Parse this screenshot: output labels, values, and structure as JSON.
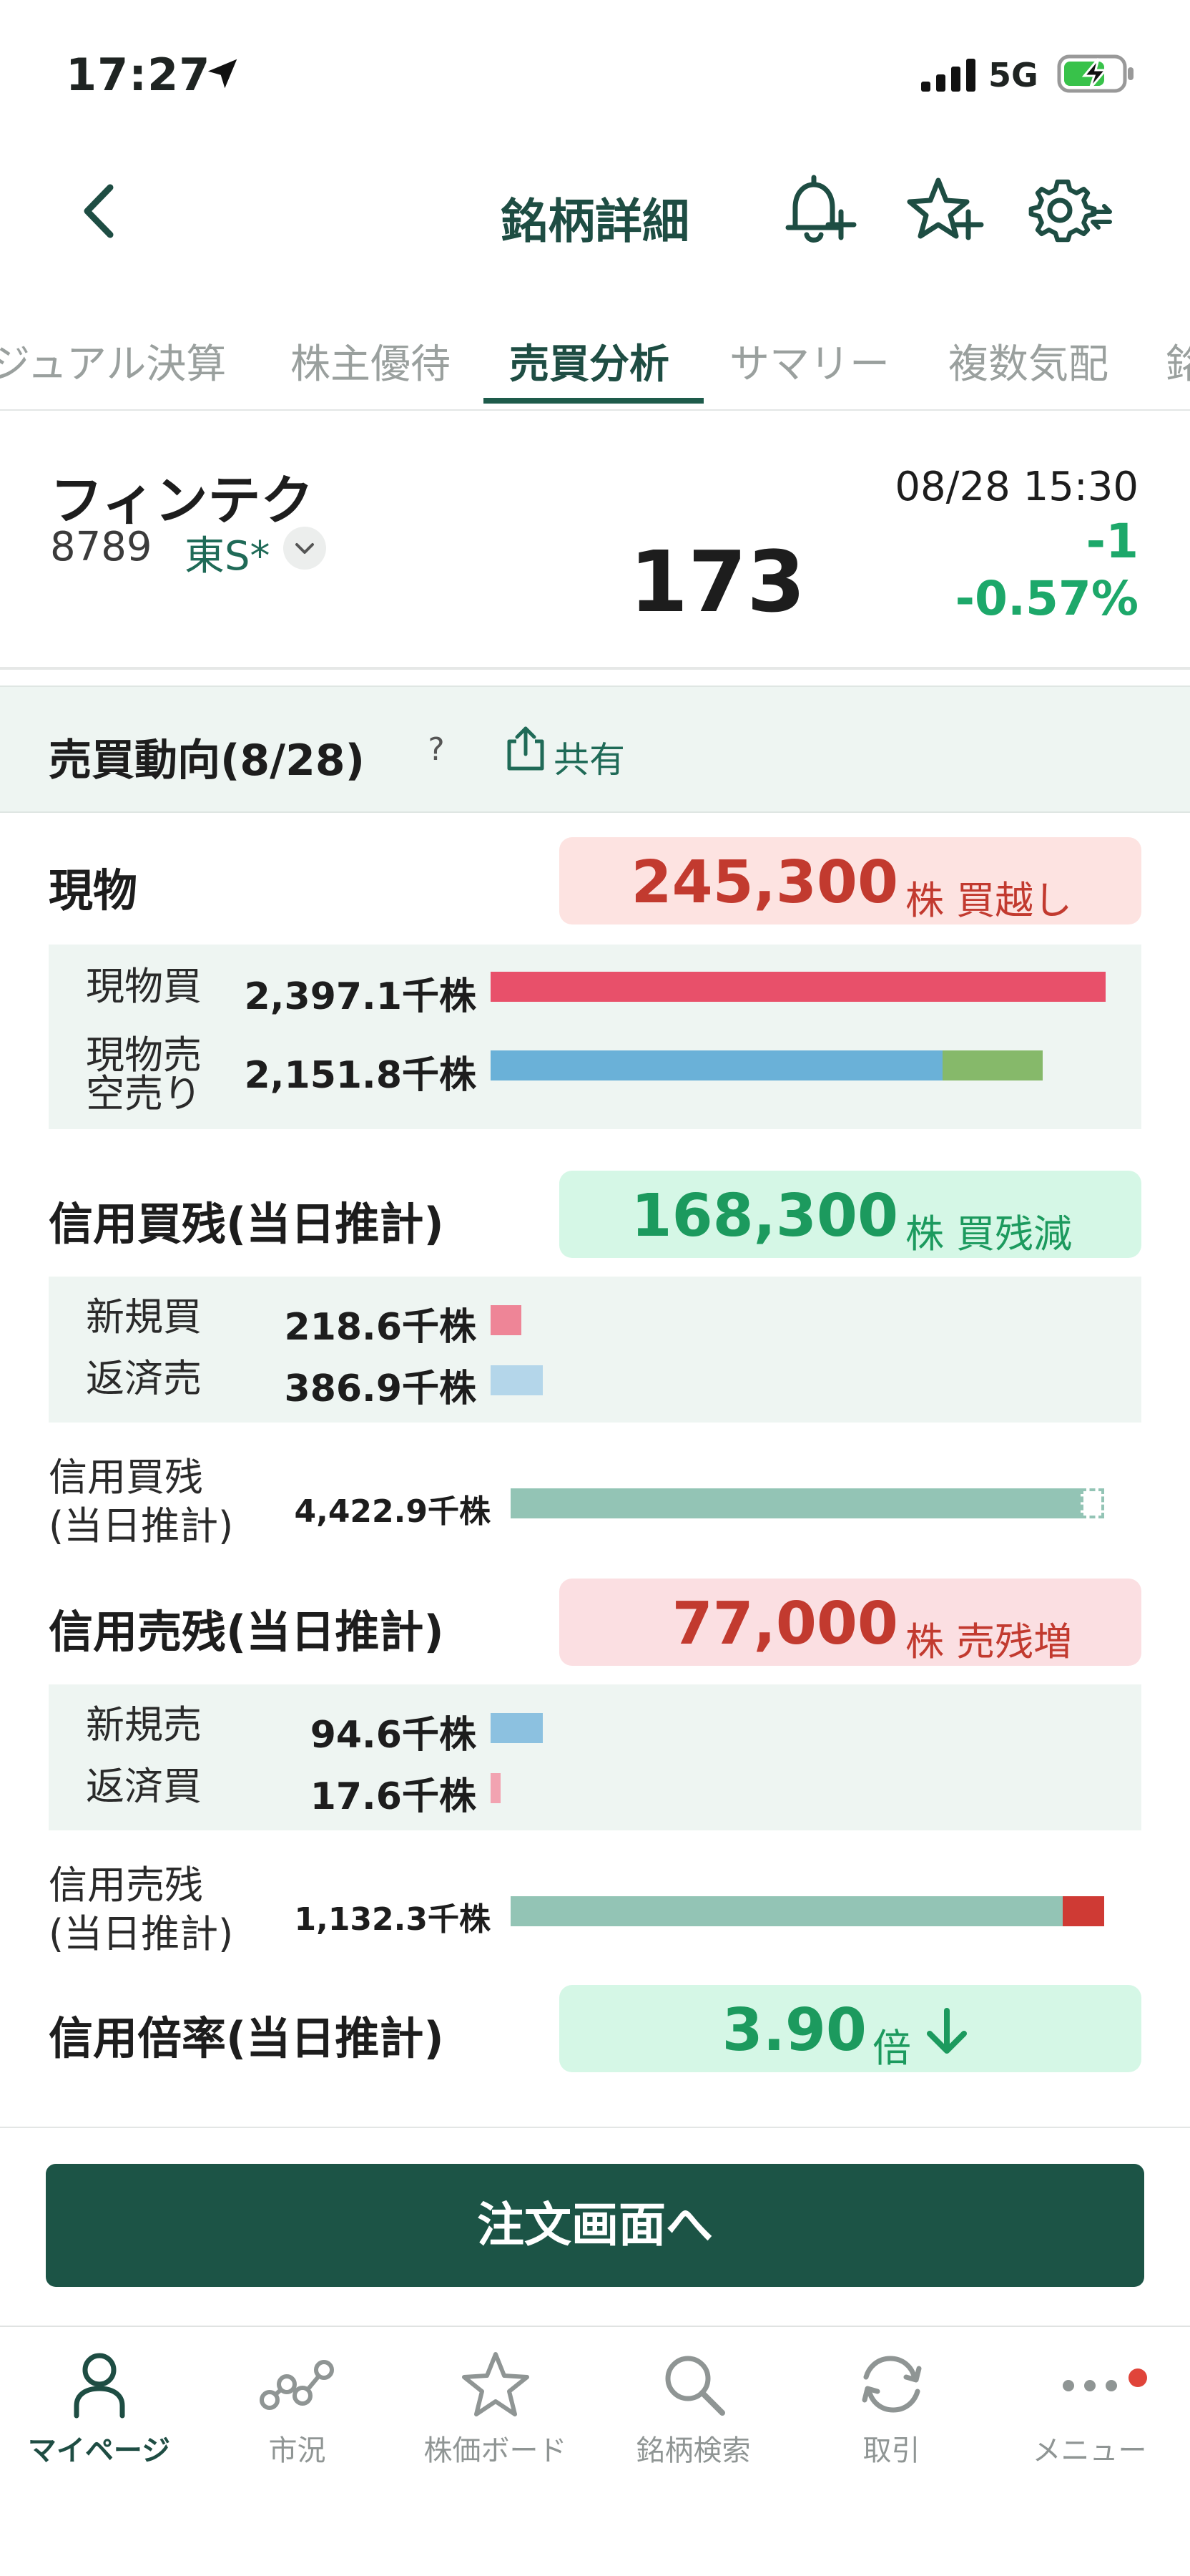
{
  "status_bar": {
    "time": "17:27",
    "network": "5G"
  },
  "header": {
    "title": "銘柄詳細"
  },
  "tabs": [
    {
      "label": "ジュアル決算"
    },
    {
      "label": "株主優待"
    },
    {
      "label": "売買分析",
      "active": true
    },
    {
      "label": "サマリー"
    },
    {
      "label": "複数気配"
    },
    {
      "label": "銘"
    }
  ],
  "stock": {
    "name": "フィンテク",
    "code": "8789",
    "market": "東S*",
    "datetime": "08/28 15:30",
    "price": "173",
    "change": "-1",
    "change_pct": "-0.57%"
  },
  "section": {
    "title": "売買動向(8/28)",
    "help": "?",
    "share": "共有"
  },
  "spot": {
    "title": "現物",
    "net": "245,300",
    "net_unit": "株 買越し",
    "buy_label": "現物買",
    "buy_value": "2,397.1千株",
    "buy_ratio": 1.0,
    "sell_label_1": "現物売",
    "sell_label_2": "空売り",
    "sell_value": "2,151.8千株",
    "sell_ratio": 0.735,
    "short_ratio": 0.163
  },
  "margin_buy": {
    "title": "信用買残(当日推計)",
    "net": "168,300",
    "net_unit": "株 買残減",
    "new_label": "新規買",
    "new_value": "218.6千株",
    "new_ratio": 0.05,
    "close_label": "返済売",
    "close_value": "386.9千株",
    "close_ratio": 0.085,
    "bal_label_1": "信用買残",
    "bal_label_2": "(当日推計)",
    "bal_value": "4,422.9千株",
    "bal_ratio": 0.96,
    "bal_ghost_ratio": 0.04
  },
  "margin_sell": {
    "title": "信用売残(当日推計)",
    "net": "77,000",
    "net_unit": "株 売残増",
    "new_label": "新規売",
    "new_value": "94.6千株",
    "new_ratio": 0.085,
    "close_label": "返済買",
    "close_value": "17.6千株",
    "close_ratio": 0.016,
    "bal_label_1": "信用売残",
    "bal_label_2": "(当日推計)",
    "bal_value": "1,132.3千株",
    "bal_ratio": 0.93,
    "bal_added_ratio": 0.07
  },
  "margin_ratio": {
    "title": "信用倍率(当日推計)",
    "value": "3.90",
    "unit": "倍"
  },
  "order_button": "注文画面へ",
  "tabbar": [
    {
      "label": "マイページ",
      "active": true
    },
    {
      "label": "市況"
    },
    {
      "label": "株価ボード"
    },
    {
      "label": "銘柄検索"
    },
    {
      "label": "取引"
    },
    {
      "label": "メニュー"
    }
  ],
  "colors": {
    "brand": "#1c5446",
    "buy_bar": "#e8506a",
    "sell_bar": "#6ab1d8",
    "short_bar": "#86b96a",
    "balance_bar": "#93c4b5",
    "down": "#1da86a"
  }
}
